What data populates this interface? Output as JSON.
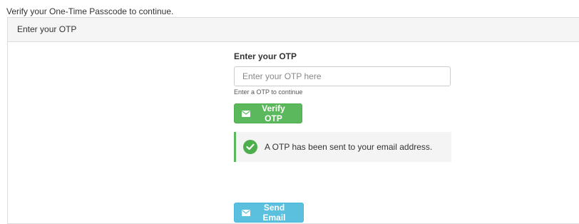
{
  "intro_text": "Verify your One-Time Passcode to continue.",
  "panel": {
    "heading": "Enter your OTP"
  },
  "form": {
    "label": "Enter your OTP",
    "otp_input": {
      "value": "",
      "placeholder": "Enter your OTP here"
    },
    "help_text": "Enter a OTP to continue",
    "verify_button": {
      "label": "Verify OTP",
      "icon": "envelope-icon"
    },
    "alert": {
      "message": "A OTP has been sent to your email address.",
      "icon": "check-circle-icon",
      "status": "success"
    },
    "send_button": {
      "label": "Send Email",
      "icon": "envelope-icon"
    }
  },
  "colors": {
    "success": "#5cb85c",
    "info": "#5bc0de",
    "panel_heading_bg": "#f5f5f5",
    "alert_bg": "#f4f4f4"
  }
}
